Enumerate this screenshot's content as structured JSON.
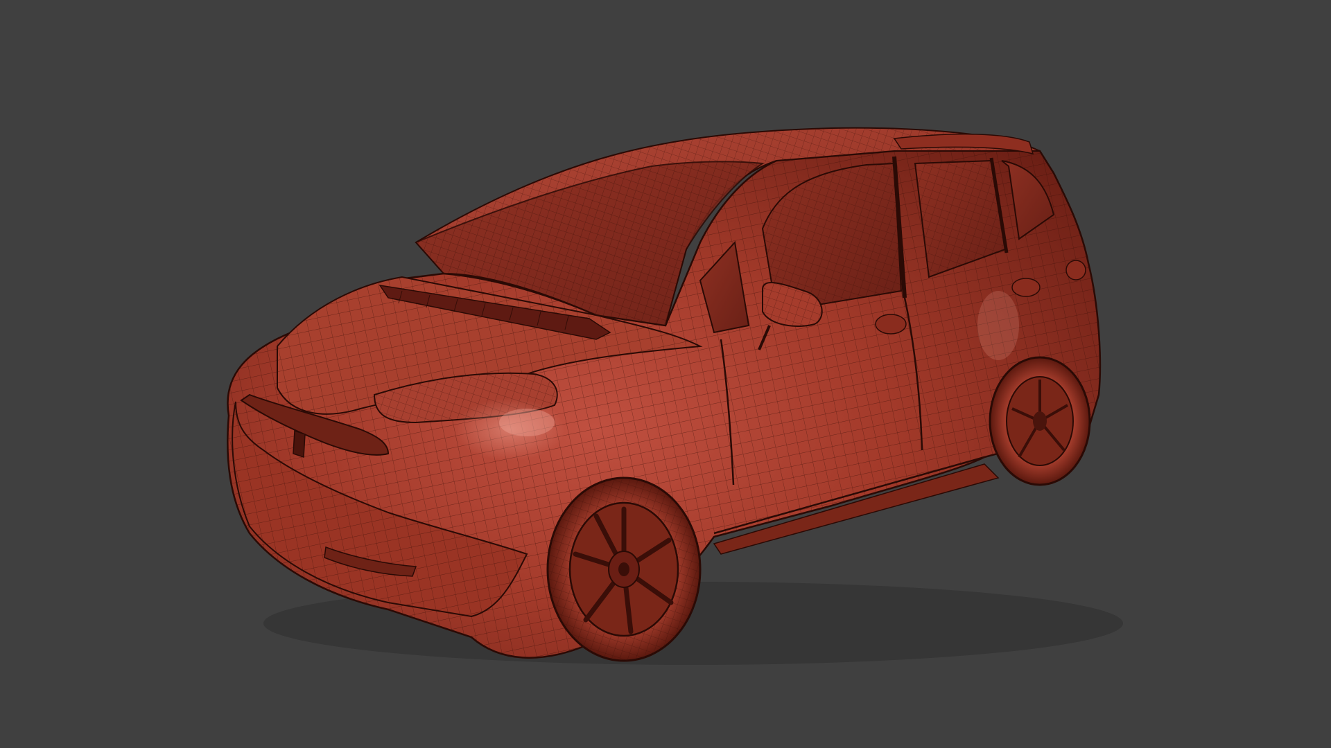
{
  "viewport": {
    "background_color": "#404040",
    "shading": "clay-wireframe"
  },
  "model": {
    "subject": "hatchback-car",
    "material_color": "#a33a2a",
    "shadow_color": "#5e1a12",
    "highlight_color": "#e0806a",
    "wire_color": "#3a0e08",
    "parts": [
      "body",
      "roof",
      "hood",
      "windshield",
      "side-windows",
      "mirror",
      "front-grille",
      "emblem",
      "headlights",
      "bumper",
      "front-wheel",
      "rear-wheel",
      "door-handles",
      "fuel-cap"
    ]
  }
}
